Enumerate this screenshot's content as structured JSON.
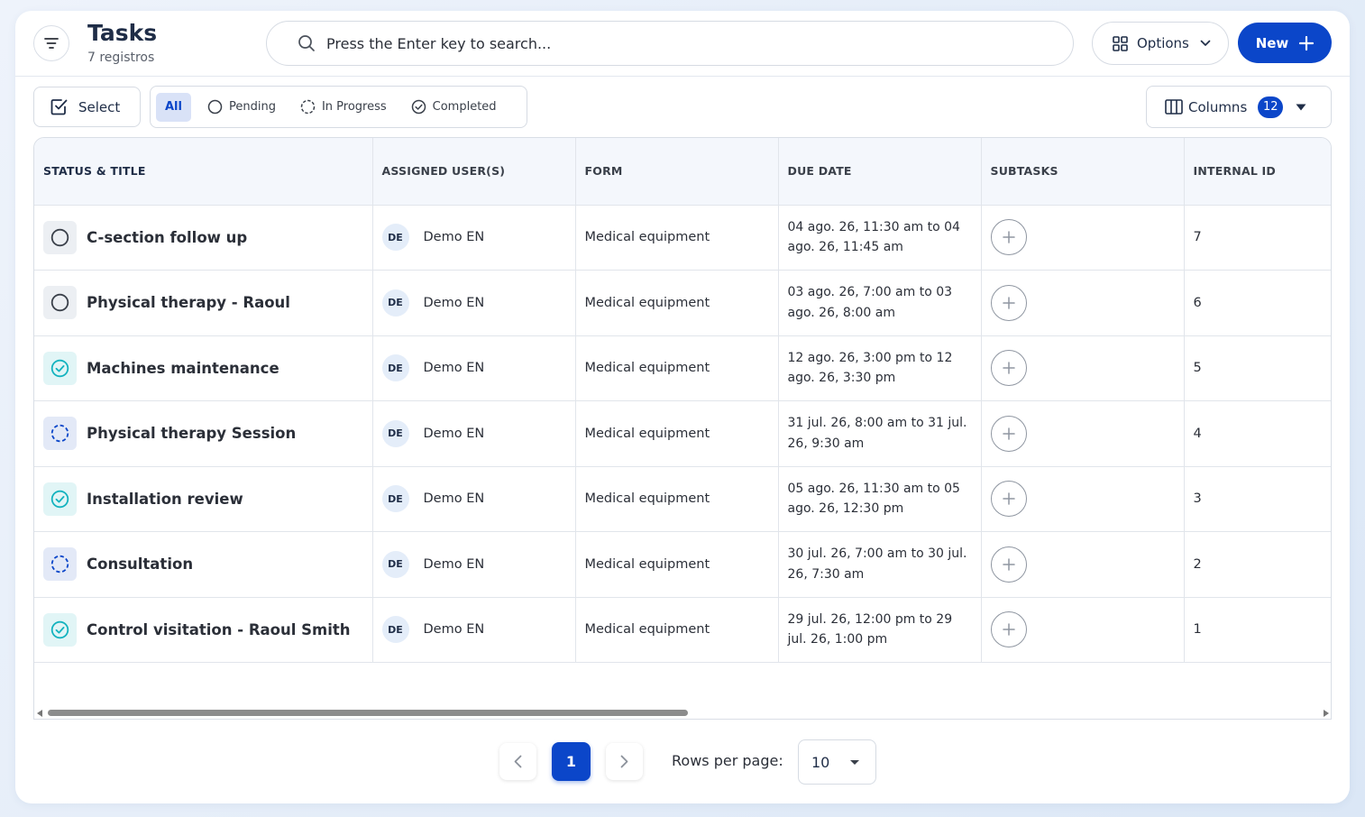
{
  "header": {
    "title": "Tasks",
    "subtitle": "7 registros",
    "search_placeholder": "Press the Enter key to search...",
    "options_label": "Options",
    "new_label": "New"
  },
  "toolbar": {
    "select_label": "Select",
    "tabs": [
      {
        "label": "All",
        "icon": "all",
        "active": true
      },
      {
        "label": "Pending",
        "icon": "circle-icon"
      },
      {
        "label": "In Progress",
        "icon": "dashed-circle-icon"
      },
      {
        "label": "Completed",
        "icon": "check-circle-icon"
      }
    ],
    "columns_label": "Columns",
    "columns_count": "12"
  },
  "table": {
    "headers": [
      "STATUS & TITLE",
      "ASSIGNED USER(S)",
      "FORM",
      "DUE DATE",
      "SUBTASKS",
      "INTERNAL ID"
    ],
    "rows": [
      {
        "status": "pending",
        "title": "C-section follow up",
        "user_initials": "DE",
        "user": "Demo EN",
        "form": "Medical equipment",
        "due": "04 ago. 26, 11:30 am to 04 ago. 26, 11:45 am",
        "id": "7"
      },
      {
        "status": "pending",
        "title": "Physical therapy - Raoul",
        "user_initials": "DE",
        "user": "Demo EN",
        "form": "Medical equipment",
        "due": "03 ago. 26, 7:00 am to 03 ago. 26, 8:00 am",
        "id": "6"
      },
      {
        "status": "completed",
        "title": "Machines maintenance",
        "user_initials": "DE",
        "user": "Demo EN",
        "form": "Medical equipment",
        "due": "12 ago. 26, 3:00 pm to 12 ago. 26, 3:30 pm",
        "id": "5"
      },
      {
        "status": "in-progress",
        "title": "Physical therapy Session",
        "user_initials": "DE",
        "user": "Demo EN",
        "form": "Medical equipment",
        "due": "31 jul. 26, 8:00 am to 31 jul. 26, 9:30 am",
        "id": "4"
      },
      {
        "status": "completed",
        "title": "Installation review",
        "user_initials": "DE",
        "user": "Demo EN",
        "form": "Medical equipment",
        "due": "05 ago. 26, 11:30 am to 05 ago. 26, 12:30 pm",
        "id": "3"
      },
      {
        "status": "in-progress",
        "title": "Consultation",
        "user_initials": "DE",
        "user": "Demo EN",
        "form": "Medical equipment",
        "due": "30 jul. 26, 7:00 am to 30 jul. 26, 7:30 am",
        "id": "2"
      },
      {
        "status": "completed",
        "title": "Control visitation - Raoul Smith",
        "user_initials": "DE",
        "user": "Demo EN",
        "form": "Medical equipment",
        "due": "29 jul. 26, 12:00 pm to 29 jul. 26, 1:00 pm",
        "id": "1"
      }
    ]
  },
  "pagination": {
    "current_page": "1",
    "rows_per_page_label": "Rows per page:",
    "rows_per_page_value": "10"
  },
  "colors": {
    "primary": "#0b46c9",
    "completed_icon": "#14b3bf",
    "in_progress_icon": "#0b46c9",
    "pending_icon": "#3a404a"
  }
}
